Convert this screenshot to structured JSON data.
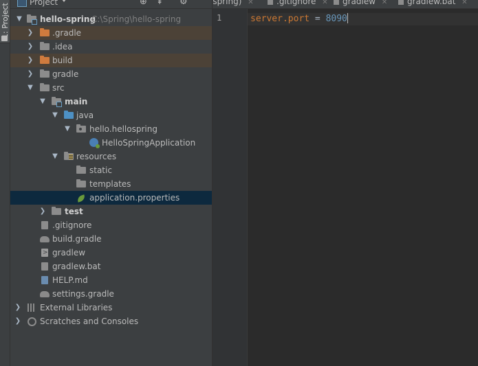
{
  "sidebar_strip": {
    "tab_label": "1: Project"
  },
  "panel": {
    "title": "Project"
  },
  "tree": {
    "root": {
      "name": "hello-spring",
      "path": "C:\\Spring\\hello-spring"
    },
    "gradle_dir": ".gradle",
    "idea_dir": ".idea",
    "build_dir": "build",
    "gradle_folder": "gradle",
    "src": "src",
    "main": "main",
    "java": "java",
    "package": "hello.hellospring",
    "app_class": "HelloSpringApplication",
    "resources": "resources",
    "static": "static",
    "templates": "templates",
    "app_properties": "application.properties",
    "test": "test",
    "gitignore": ".gitignore",
    "build_gradle": "build.gradle",
    "gradlew": "gradlew",
    "gradlew_bat": "gradlew.bat",
    "help_md": "HELP.md",
    "settings_gradle": "settings.gradle",
    "external_libraries": "External Libraries",
    "scratches": "Scratches and Consoles"
  },
  "editor": {
    "tabs": [
      "-spring)",
      ".gitignore",
      "gradlew",
      "gradlew.bat"
    ],
    "line_number": "1",
    "code": {
      "key": "server.port",
      "op": " = ",
      "value": "8090"
    }
  },
  "colors": {
    "highlight_row": "#4c4237",
    "selected_row": "#0d293e",
    "key": "#cc7832",
    "number": "#6897bb"
  }
}
